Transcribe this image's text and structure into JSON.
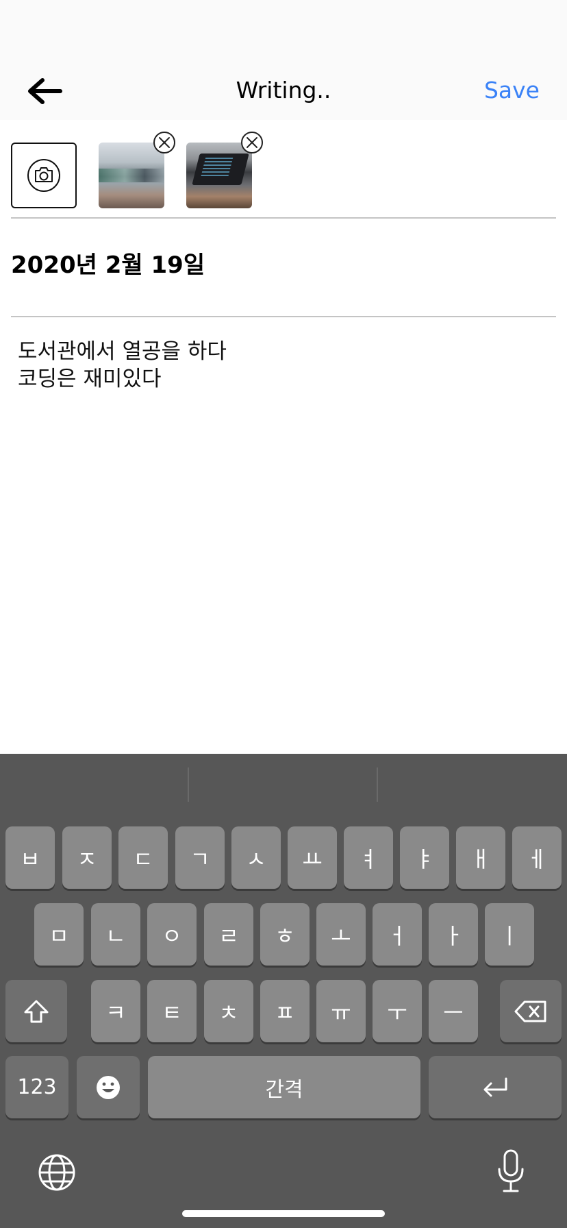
{
  "nav": {
    "title": "Writing..",
    "save_label": "Save"
  },
  "attachments": {
    "photos": [
      "photo-library",
      "photo-laptop"
    ]
  },
  "entry": {
    "date": "2020년 2월 19일",
    "lines": [
      "도서관에서 열공을 하다",
      "코딩은 재미있다"
    ]
  },
  "keyboard": {
    "row1": [
      "ㅂ",
      "ㅈ",
      "ㄷ",
      "ㄱ",
      "ㅅ",
      "ㅛ",
      "ㅕ",
      "ㅑ",
      "ㅐ",
      "ㅔ"
    ],
    "row2": [
      "ㅁ",
      "ㄴ",
      "ㅇ",
      "ㄹ",
      "ㅎ",
      "ㅗ",
      "ㅓ",
      "ㅏ",
      "ㅣ"
    ],
    "row3": [
      "ㅋ",
      "ㅌ",
      "ㅊ",
      "ㅍ",
      "ㅠ",
      "ㅜ",
      "ㅡ"
    ],
    "numbers_label": "123",
    "space_label": "간격"
  },
  "colors": {
    "accent": "#3a82f7",
    "keyboard_bg": "#575757",
    "key_bg": "#8a8a8a"
  }
}
